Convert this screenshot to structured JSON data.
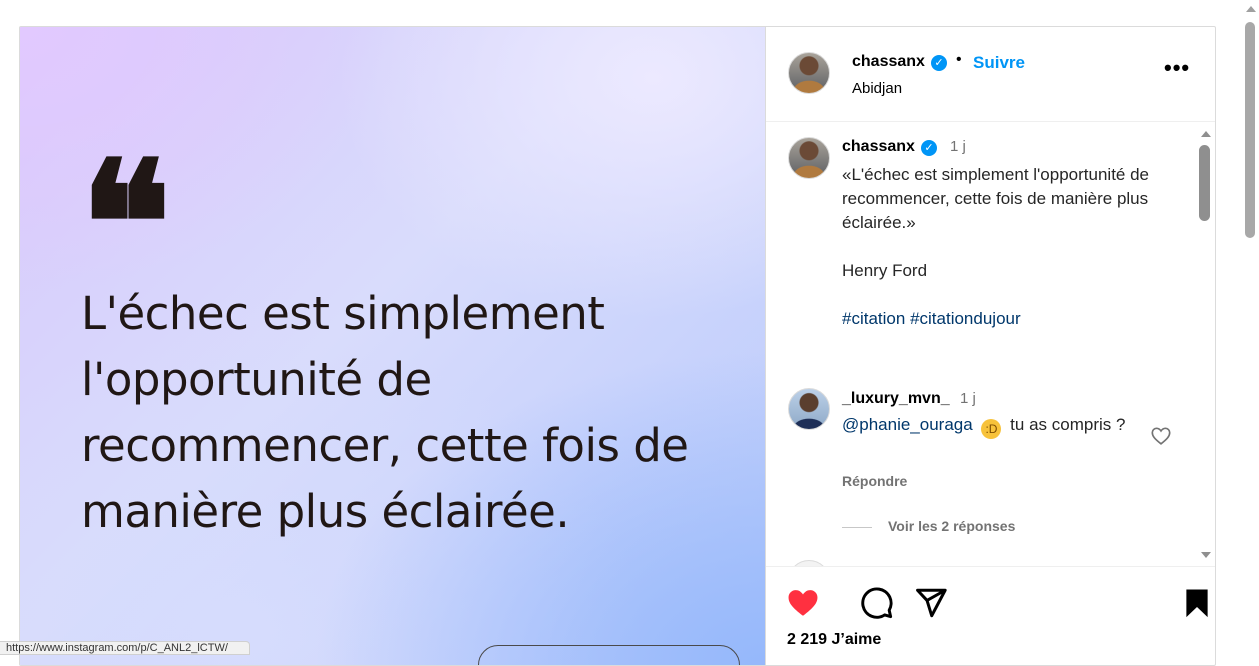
{
  "post": {
    "image": {
      "quote_mark": "❝",
      "quote_text": "L'échec est simplement l'opportunité de recommencer, cette fois de manière plus éclairée."
    },
    "status_url": "https://www.instagram.com/p/C_ANL2_lCTW/"
  },
  "header": {
    "username": "chassanx",
    "verified_icon": "verified-badge-icon",
    "separator": "•",
    "follow_label": "Suivre",
    "location": "Abidjan",
    "more_label": "•••"
  },
  "caption": {
    "username": "chassanx",
    "time": "1 j",
    "lines": [
      "«L'échec est simplement l'opportunité de recommencer, cette fois de manière plus éclairée.»",
      "",
      "Henry Ford",
      ""
    ],
    "hashtags": [
      "#citation",
      "#citationdujour"
    ]
  },
  "comment": {
    "username": "_luxury_mvn_",
    "time": "1 j",
    "mention": "@phanie_ouraga",
    "emoji": "🤣",
    "text": "tu as compris ?",
    "reply_label": "Répondre",
    "view_replies_label": "Voir les 2 réponses"
  },
  "actions": {
    "likes_text": "2 219 J’aime",
    "like_color": "#ff3040"
  },
  "colors": {
    "accent": "#0095f6",
    "link": "#00376b",
    "muted": "#737373"
  }
}
